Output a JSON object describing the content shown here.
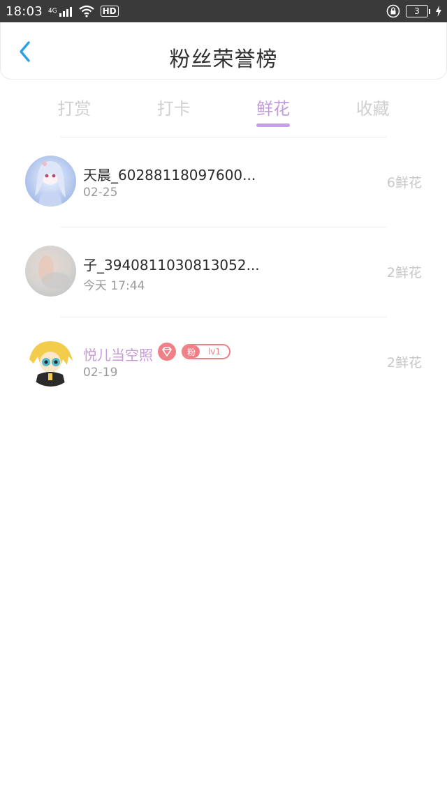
{
  "status_bar": {
    "time": "18:03",
    "network_label": "4G",
    "hd_label": "HD",
    "battery_level": "3"
  },
  "header": {
    "title": "粉丝荣誉榜"
  },
  "tabs": [
    {
      "label": "打赏",
      "active": false
    },
    {
      "label": "打卡",
      "active": false
    },
    {
      "label": "鲜花",
      "active": true
    },
    {
      "label": "收藏",
      "active": false
    }
  ],
  "list": [
    {
      "name": "天晨_60288118097600...",
      "time": "02-25",
      "count": "6鲜花",
      "avatar": "anime-girl-avatar"
    },
    {
      "name": "子_3940811030813052...",
      "time": "今天 17:44",
      "count": "2鲜花",
      "avatar": "blurred-photo-avatar"
    },
    {
      "name": "悦儿当空照",
      "time": "02-19",
      "count": "2鲜花",
      "avatar": "anime-blonde-avatar",
      "fan_badge_label": "粉",
      "fan_badge_level": "lv1"
    }
  ],
  "colors": {
    "accent": "#c39bde",
    "badge_pink": "#f07f87",
    "back_arrow": "#2aa0e8"
  }
}
